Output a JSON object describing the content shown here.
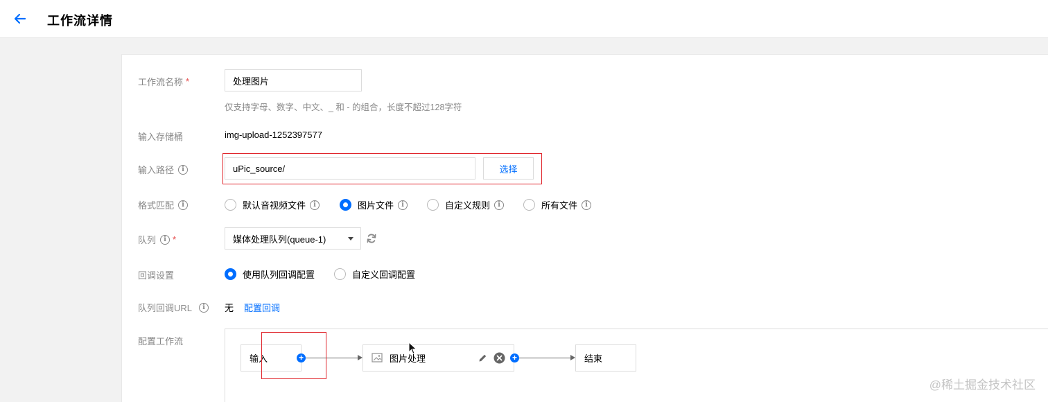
{
  "header": {
    "title": "工作流详情"
  },
  "form": {
    "name_label": "工作流名称",
    "required_mark": "*",
    "name_value": "处理图片",
    "name_hint": "仅支持字母、数字、中文、_ 和 - 的组合，长度不超过128字符",
    "bucket_label": "输入存储桶",
    "bucket_value": "img-upload-1252397577",
    "path_label": "输入路径",
    "path_value": "uPic_source/",
    "path_button": "选择",
    "format_label": "格式匹配",
    "format_options": [
      {
        "label": "默认音视频文件",
        "selected": false
      },
      {
        "label": "图片文件",
        "selected": true
      },
      {
        "label": "自定义规则",
        "selected": false
      },
      {
        "label": "所有文件",
        "selected": false
      }
    ],
    "queue_label": "队列",
    "queue_value": "媒体处理队列(queue-1)",
    "callback_label": "回调设置",
    "callback_options": [
      {
        "label": "使用队列回调配置",
        "selected": true
      },
      {
        "label": "自定义回调配置",
        "selected": false
      }
    ],
    "queue_callback_label": "队列回调URL",
    "queue_callback_value": "无",
    "queue_callback_link": "配置回调",
    "workflow_label": "配置工作流"
  },
  "workflow": {
    "nodes": [
      {
        "label": "输入"
      },
      {
        "label": "图片处理"
      },
      {
        "label": "结束"
      }
    ]
  },
  "icons": {
    "back": "arrow-left-icon",
    "info": "info-icon",
    "refresh": "refresh-icon",
    "edit": "pencil-icon",
    "delete": "close-circle-icon",
    "add": "plus-circle-icon",
    "image": "image-icon"
  },
  "colors": {
    "accent": "#006eff",
    "highlight": "#e0252b",
    "label": "#888888"
  },
  "watermark": "@稀土掘金技术社区"
}
